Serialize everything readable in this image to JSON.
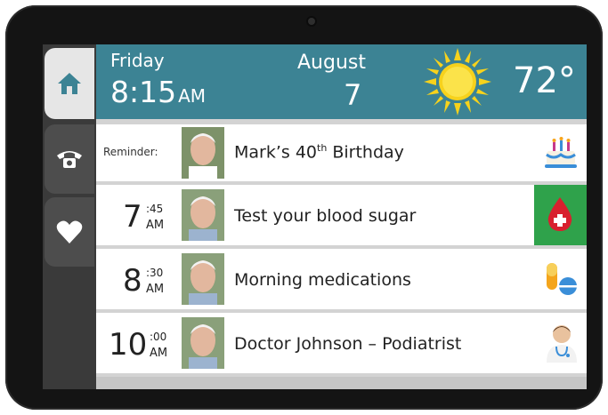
{
  "header": {
    "day": "Friday",
    "time": "8:15",
    "ampm": "AM",
    "month": "August",
    "date": "7",
    "temperature": "72°",
    "weather_icon": "sun-icon",
    "color": "#3c8394"
  },
  "side_tabs": [
    {
      "icon": "home-icon",
      "selected": true
    },
    {
      "icon": "phone-icon",
      "selected": false
    },
    {
      "icon": "heart-icon",
      "selected": false
    }
  ],
  "reminder": {
    "label": "Reminder:",
    "text": "Mark’s 40",
    "superscript": "th",
    "text_after": " Birthday",
    "icon": "birthday-cake-icon"
  },
  "events": [
    {
      "hour": "7",
      "minutes": ":45",
      "ampm": "AM",
      "text": "Test your blood sugar",
      "icon": "blood-drop-icon",
      "highlight": "#2fa24b"
    },
    {
      "hour": "8",
      "minutes": ":30",
      "ampm": "AM",
      "text": "Morning medications",
      "icon": "pills-icon"
    },
    {
      "hour": "10",
      "minutes": ":00",
      "ampm": "AM",
      "text": "Doctor Johnson – Podiatrist",
      "icon": "doctor-icon"
    }
  ]
}
